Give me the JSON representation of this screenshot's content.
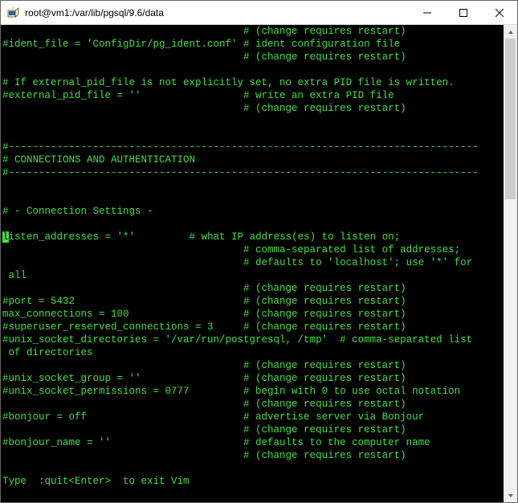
{
  "window": {
    "title": "root@vm1:/var/lib/pgsql/9.6/data"
  },
  "cursor_char": "l",
  "term_lines": [
    "                                        # (change requires restart)",
    "#ident_file = 'ConfigDir/pg_ident.conf' # ident configuration file",
    "                                        # (change requires restart)",
    "",
    "# If external_pid_file is not explicitly set, no extra PID file is written.",
    "#external_pid_file = ''                 # write an extra PID file",
    "                                        # (change requires restart)",
    "",
    "",
    "#------------------------------------------------------------------------------",
    "# CONNECTIONS AND AUTHENTICATION",
    "#------------------------------------------------------------------------------",
    "",
    "",
    "# - Connection Settings -",
    "",
    "isten_addresses = '*'         # what IP address(es) to listen on;",
    "                                        # comma-separated list of addresses;",
    "                                        # defaults to 'localhost'; use '*' for",
    " all",
    "                                        # (change requires restart)",
    "#port = 5432                            # (change requires restart)",
    "max_connections = 100                   # (change requires restart)",
    "#superuser_reserved_connections = 3     # (change requires restart)",
    "#unix_socket_directories = '/var/run/postgresql, /tmp'  # comma-separated list",
    " of directories",
    "                                        # (change requires restart)",
    "#unix_socket_group = ''                 # (change requires restart)",
    "#unix_socket_permissions = 0777         # begin with 0 to use octal notation",
    "                                        # (change requires restart)",
    "#bonjour = off                          # advertise server via Bonjour",
    "                                        # (change requires restart)",
    "#bonjour_name = ''                      # defaults to the computer name",
    "                                        # (change requires restart)",
    "",
    "Type  :quit<Enter>  to exit Vim"
  ],
  "cursor_line_index": 16
}
